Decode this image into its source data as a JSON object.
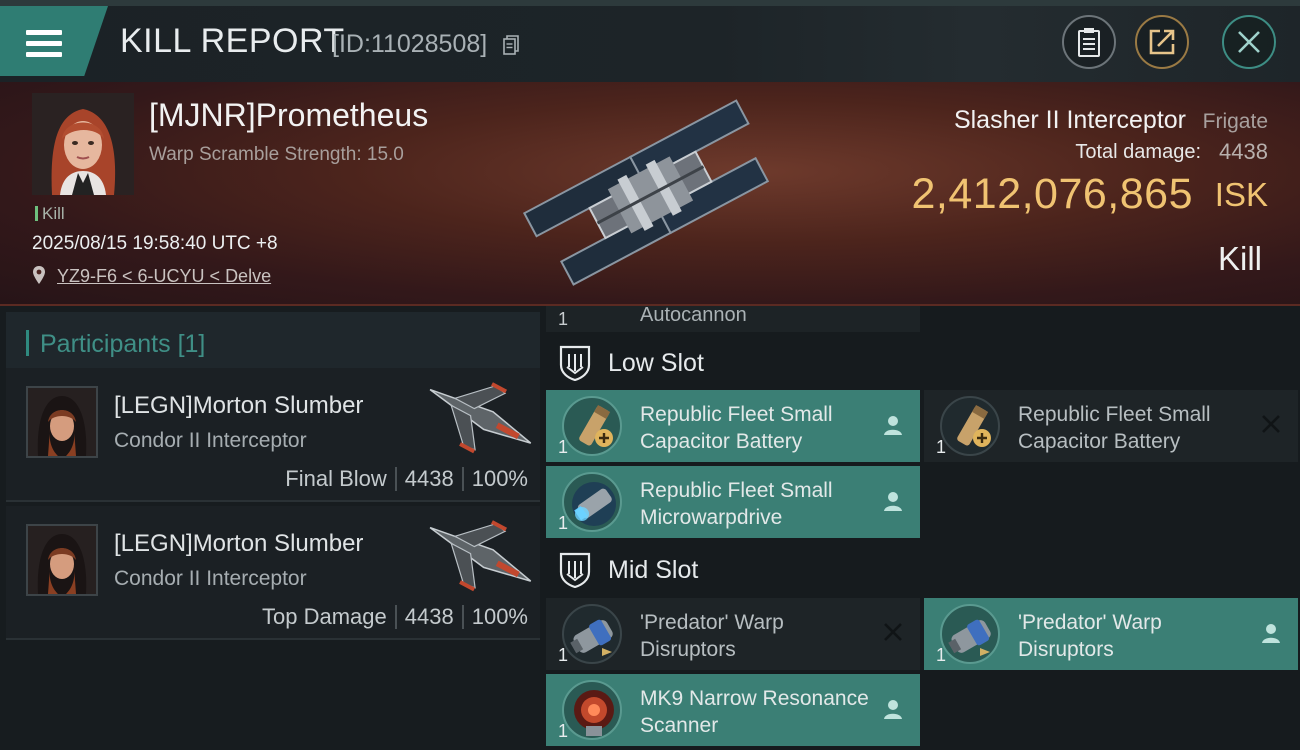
{
  "header": {
    "title": "KILL REPORT",
    "report_id": "[ID:11028508]",
    "icons": [
      "menu-icon",
      "copy-icon",
      "clipboard-icon",
      "share-icon",
      "close-icon"
    ]
  },
  "victim": {
    "name": "[MJNR]Prometheus",
    "subtitle": "Warp Scramble Strength: 15.0",
    "result_tag": "Kill",
    "timestamp": "2025/08/15 19:58:40 UTC +8",
    "location": "YZ9-F6 < 6-UCYU < Delve",
    "ship_name": "Slasher II Interceptor",
    "ship_class": "Frigate",
    "damage_label": "Total damage:",
    "damage_value": "4438",
    "isk_value": "2,412,076,865",
    "isk_unit": "ISK",
    "result": "Kill",
    "colors": {
      "isk": "#f0c372",
      "accent": "#2f8a80"
    }
  },
  "participants": {
    "label": "Participants",
    "count": "[1]",
    "rows": [
      {
        "name": "[LEGN]Morton Slumber",
        "ship": "Condor II Interceptor",
        "role": "Final Blow",
        "damage": "4438",
        "percent": "100%"
      },
      {
        "name": "[LEGN]Morton Slumber",
        "ship": "Condor II Interceptor",
        "role": "Top Damage",
        "damage": "4438",
        "percent": "100%"
      }
    ]
  },
  "fitting": {
    "partial_item": {
      "qty": "1",
      "name": "Autocannon"
    },
    "low_slot": {
      "label": "Low Slot",
      "modules": [
        {
          "qty": "1",
          "name": "Republic Fleet Small Capacitor Battery",
          "state": "fitted",
          "icon": "capacitor-battery-icon"
        },
        {
          "qty": "1",
          "name": "Republic Fleet Small Capacitor Battery",
          "state": "destroyed",
          "icon": "capacitor-battery-icon"
        },
        {
          "qty": "1",
          "name": "Republic Fleet Small Microwarpdrive",
          "state": "fitted",
          "icon": "microwarpdrive-icon"
        }
      ]
    },
    "mid_slot": {
      "label": "Mid Slot",
      "modules": [
        {
          "qty": "1",
          "name": "'Predator' Warp Disruptors",
          "state": "destroyed",
          "icon": "warp-disruptor-icon"
        },
        {
          "qty": "1",
          "name": "'Predator' Warp Disruptors",
          "state": "fitted",
          "icon": "warp-disruptor-icon"
        },
        {
          "qty": "1",
          "name": "MK9 Narrow Resonance Scanner",
          "state": "fitted",
          "icon": "scanner-icon"
        }
      ]
    }
  }
}
